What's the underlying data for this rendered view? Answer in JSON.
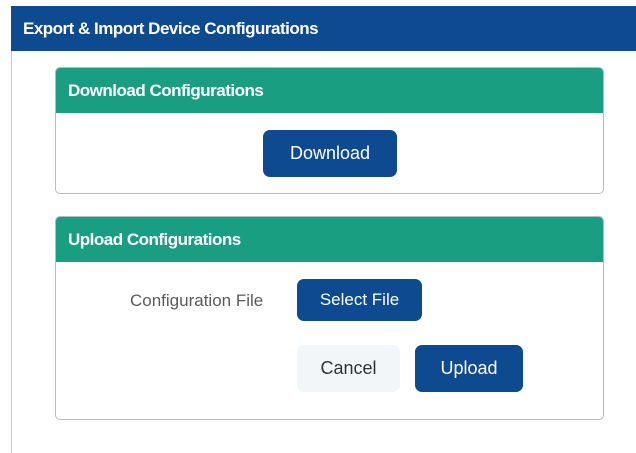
{
  "header": {
    "title": "Export & Import Device Configurations"
  },
  "download_section": {
    "title": "Download Configurations",
    "download_button": "Download"
  },
  "upload_section": {
    "title": "Upload Configurations",
    "file_label": "Configuration File",
    "select_file_button": "Select File",
    "cancel_button": "Cancel",
    "upload_button": "Upload"
  },
  "colors": {
    "header_bg": "#0e4a8f",
    "card_header_bg": "#1a9e82",
    "primary_button": "#0e4a8f",
    "light_button": "#f3f6f9"
  }
}
